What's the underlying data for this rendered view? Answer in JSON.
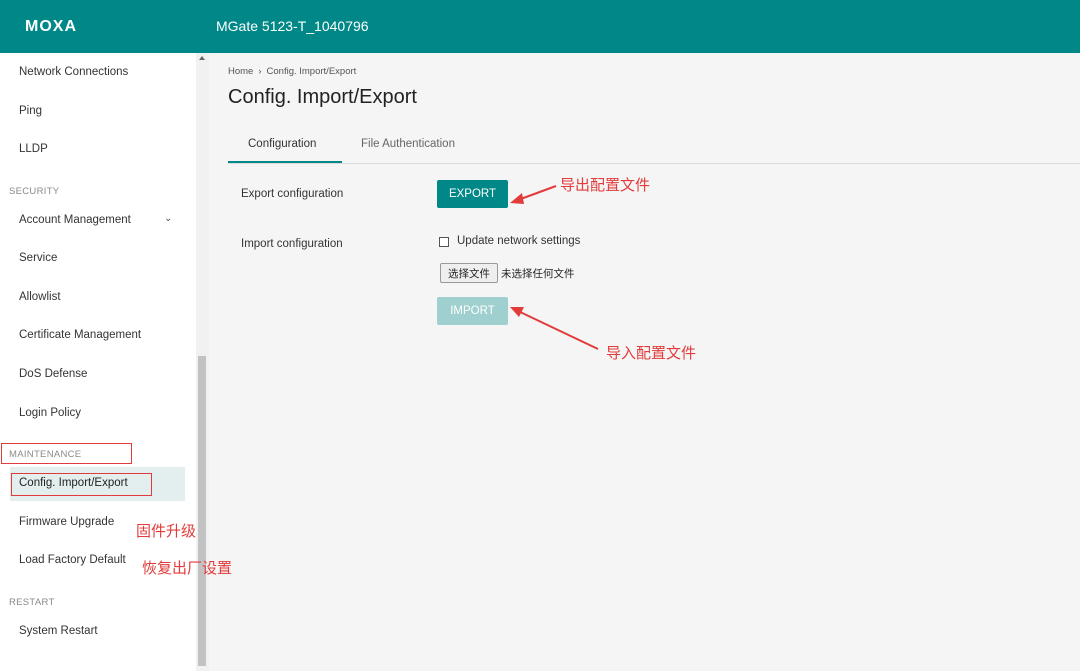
{
  "header": {
    "logo": "MOXA",
    "device_title": "MGate 5123-T_1040796"
  },
  "sidebar": {
    "items_top": [
      "Network Connections",
      "Ping",
      "LLDP"
    ],
    "security_label": "SECURITY",
    "security_items": [
      "Account Management",
      "Service",
      "Allowlist",
      "Certificate Management",
      "DoS Defense",
      "Login Policy"
    ],
    "maintenance_label": "MAINTENANCE",
    "maintenance_items": [
      "Config. Import/Export",
      "Firmware Upgrade",
      "Load Factory Default"
    ],
    "restart_label": "RESTART",
    "restart_items": [
      "System Restart"
    ]
  },
  "breadcrumb": {
    "home": "Home",
    "current": "Config. Import/Export"
  },
  "page_title": "Config. Import/Export",
  "tabs": [
    {
      "label": "Configuration"
    },
    {
      "label": "File Authentication"
    }
  ],
  "export": {
    "label": "Export configuration",
    "button": "EXPORT"
  },
  "import": {
    "label": "Import configuration",
    "checkbox_label": "Update network settings",
    "file_button": "选择文件",
    "file_status": "未选择任何文件",
    "button": "IMPORT"
  },
  "annotations": {
    "export_note": "导出配置文件",
    "import_note": "导入配置文件",
    "firmware_note": "固件升级",
    "factory_note": "恢复出厂设置"
  },
  "colors": {
    "header": "#008787",
    "accent": "#008787",
    "disabled_button": "#9fcfcf",
    "annotation": "#e23b3b"
  }
}
